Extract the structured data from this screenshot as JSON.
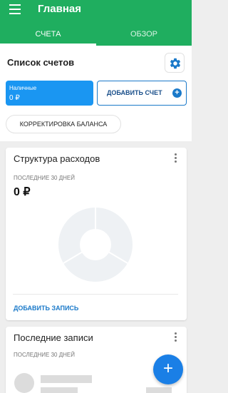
{
  "header": {
    "title": "Главная"
  },
  "tabs": [
    {
      "label": "СЧЕТА",
      "active": true
    },
    {
      "label": "ОБЗОР",
      "active": false
    }
  ],
  "accounts": {
    "title": "Список счетов",
    "items": [
      {
        "name": "Наличные",
        "balance": "0 ₽"
      }
    ],
    "add_button": "ДОБАВИТЬ СЧЕТ",
    "balance_button": "КОРРЕКТИРОВКА БАЛАНСА"
  },
  "expenses": {
    "title": "Структура расходов",
    "period": "ПОСЛЕДНИЕ 30 ДНЕЙ",
    "total": "0 ₽",
    "add_record": "ДОБАВИТЬ ЗАПИСЬ"
  },
  "recent": {
    "title": "Последние записи",
    "period": "ПОСЛЕДНИЕ 30 ДНЕЙ"
  },
  "fab": {
    "symbol": "+"
  },
  "colors": {
    "primary": "#1fae5f",
    "accent": "#1a96f2",
    "link": "#1a79c9",
    "placeholder": "#dcdcdc"
  },
  "icons": [
    "menu-icon",
    "gear-icon",
    "plus-circle-icon",
    "more-vertical-icon",
    "plus-icon"
  ]
}
